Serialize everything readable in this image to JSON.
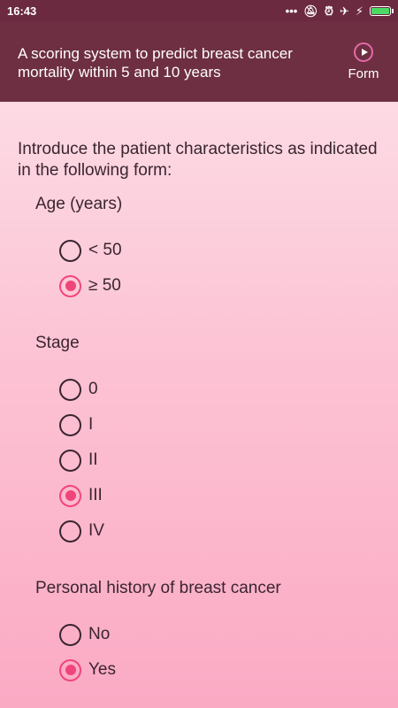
{
  "status_bar": {
    "time": "16:43"
  },
  "app_bar": {
    "title": "A scoring system to predict breast cancer mortality within 5 and 10 years",
    "form_label": "Form"
  },
  "intro": "Introduce the patient characteristics as indicated in the following form:",
  "age": {
    "label": "Age (years)",
    "options": [
      {
        "label": "< 50",
        "checked": false
      },
      {
        "label": "≥ 50",
        "checked": true
      }
    ]
  },
  "stage": {
    "label": "Stage",
    "options": [
      {
        "label": "0",
        "checked": false
      },
      {
        "label": "I",
        "checked": false
      },
      {
        "label": "II",
        "checked": false
      },
      {
        "label": "III",
        "checked": true
      },
      {
        "label": "IV",
        "checked": false
      }
    ]
  },
  "history": {
    "label": "Personal history of breast cancer",
    "options": [
      {
        "label": "No",
        "checked": false
      },
      {
        "label": "Yes",
        "checked": true
      }
    ]
  },
  "colors": {
    "app_bar": "#6e2f42",
    "accent": "#f0457a"
  }
}
